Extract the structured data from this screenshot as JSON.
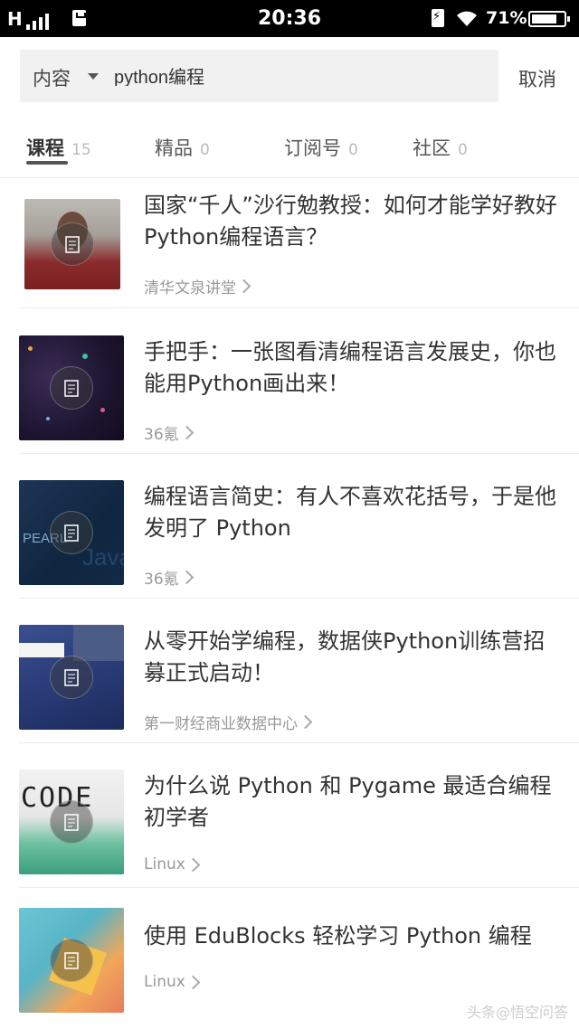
{
  "status_bar": {
    "signal": "H",
    "time": "20:36",
    "battery_percent": "71%"
  },
  "search": {
    "scope_label": "内容",
    "query": "python编程",
    "cancel_label": "取消"
  },
  "tabs": [
    {
      "label": "课程",
      "count": "15",
      "active": true
    },
    {
      "label": "精品",
      "count": "0",
      "active": false
    },
    {
      "label": "订阅号",
      "count": "0",
      "active": false
    },
    {
      "label": "社区",
      "count": "0",
      "active": false
    }
  ],
  "results": [
    {
      "title": "国家“千人”沙行勉教授：如何才能学好教好Python编程语言？",
      "source": "清华文泉讲堂"
    },
    {
      "title": "手把手：一张图看清编程语言发展史，你也能用Python画出来！",
      "source": "36氪"
    },
    {
      "title": "编程语言简史：有人不喜欢花括号，于是他发明了 Python",
      "source": "36氪"
    },
    {
      "title": "从零开始学编程，数据侠Python训练营招募正式启动！",
      "source": "第一财经商业数据中心"
    },
    {
      "title": "为什么说 Python 和 Pygame 最适合编程初学者",
      "source": "Linux"
    },
    {
      "title": "使用 EduBlocks 轻松学习 Python 编程",
      "source": "Linux"
    }
  ],
  "watermark": "头条@悟空问答"
}
